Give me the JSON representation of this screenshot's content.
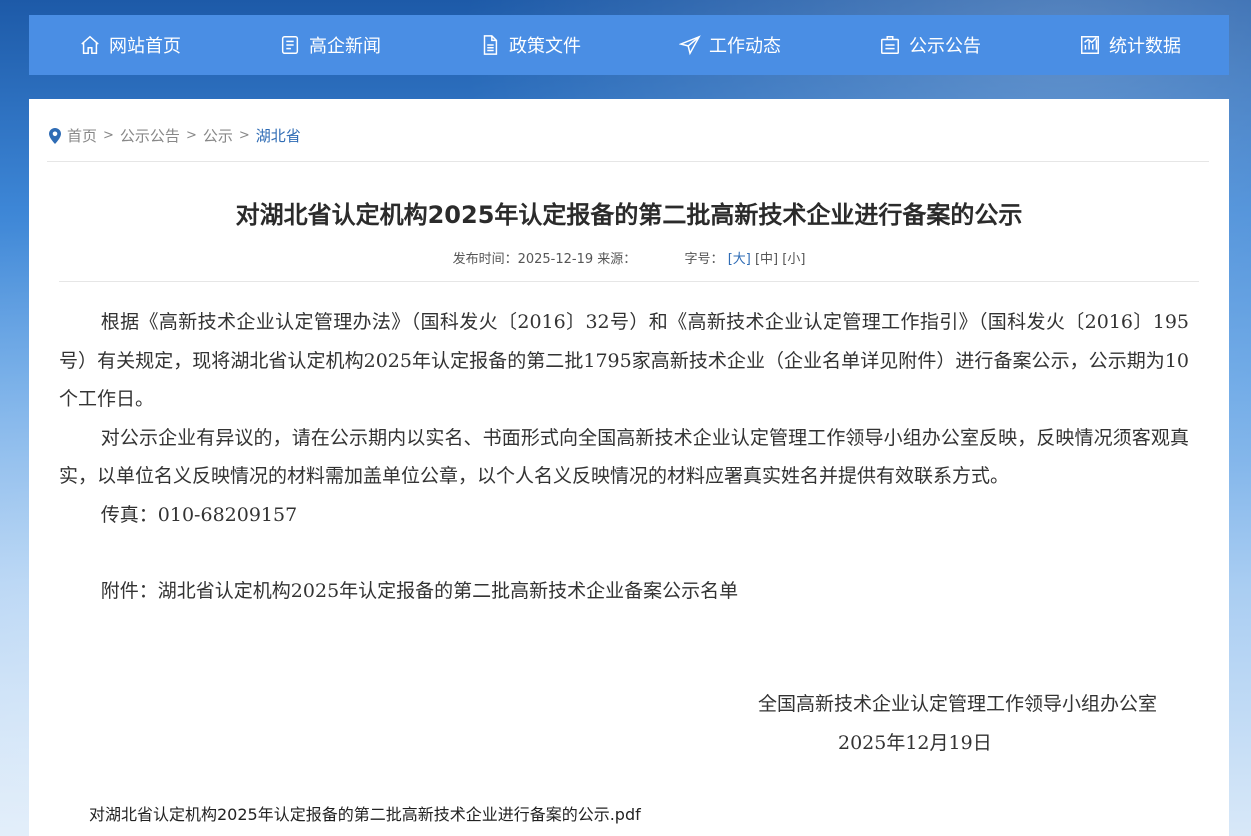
{
  "nav": {
    "items": [
      {
        "label": "网站首页",
        "icon": "home-icon"
      },
      {
        "label": "高企新闻",
        "icon": "news-icon"
      },
      {
        "label": "政策文件",
        "icon": "document-icon"
      },
      {
        "label": "工作动态",
        "icon": "send-icon"
      },
      {
        "label": "公示公告",
        "icon": "notice-icon"
      },
      {
        "label": "统计数据",
        "icon": "chart-icon"
      }
    ]
  },
  "breadcrumb": {
    "items": [
      "首页",
      "公示公告",
      "公示"
    ],
    "current": "湖北省",
    "separator": ">"
  },
  "article": {
    "title": "对湖北省认定机构2025年认定报备的第二批高新技术企业进行备案的公示",
    "meta_prefix": "发布时间：2025-12-19 来源：",
    "font_label": "字号：",
    "font_sizes": [
      "[大]",
      "[中]",
      "[小]"
    ],
    "paragraphs": [
      "根据《高新技术企业认定管理办法》（国科发火〔2016〕32号）和《高新技术企业认定管理工作指引》（国科发火〔2016〕195号）有关规定，现将湖北省认定机构2025年认定报备的第二批1795家高新技术企业（企业名单详见附件）进行备案公示，公示期为10个工作日。",
      "对公示企业有异议的，请在公示期内以实名、书面形式向全国高新技术企业认定管理工作领导小组办公室反映，反映情况须客观真实，以单位名义反映情况的材料需加盖单位公章，以个人名义反映情况的材料应署真实姓名并提供有效联系方式。",
      "传真：010-68209157"
    ],
    "attachment_note": "附件：湖北省认定机构2025年认定报备的第二批高新技术企业备案公示名单",
    "signature": "全国高新技术企业认定管理工作领导小组办公室",
    "sign_date": "2025年12月19日",
    "attachment_link": "对湖北省认定机构2025年认定报备的第二批高新技术企业进行备案的公示.pdf"
  },
  "colors": {
    "nav_bg": "#4a8ee4",
    "link_blue": "#2f6cb5",
    "title_text": "#2b2b2b",
    "body_text": "#333333"
  }
}
